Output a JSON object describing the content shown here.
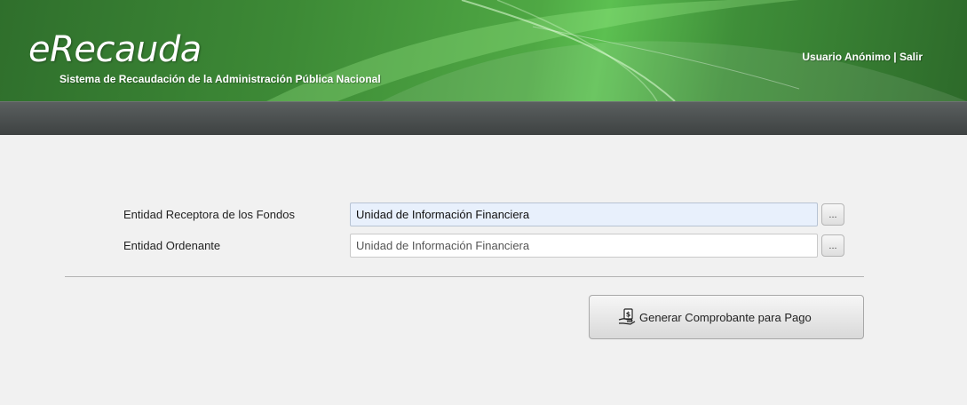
{
  "header": {
    "logo_text": "eRecauda",
    "subtitle": "Sistema de Recaudación de la Administración Pública Nacional",
    "user_label": "Usuario Anónimo |",
    "logout_label": "Salir",
    "colors": {
      "header_green": "#3d8a36",
      "navbar": "#45494a"
    }
  },
  "form": {
    "fields": [
      {
        "label": "Entidad Receptora de los Fondos",
        "value": "Unidad de Información Financiera",
        "lookup_label": "..."
      },
      {
        "label": "Entidad Ordenante",
        "value": "Unidad de Información Financiera",
        "lookup_label": "..."
      }
    ]
  },
  "actions": {
    "generate_label": "Generar Comprobante para Pago",
    "generate_icon": "money-hand-icon"
  }
}
